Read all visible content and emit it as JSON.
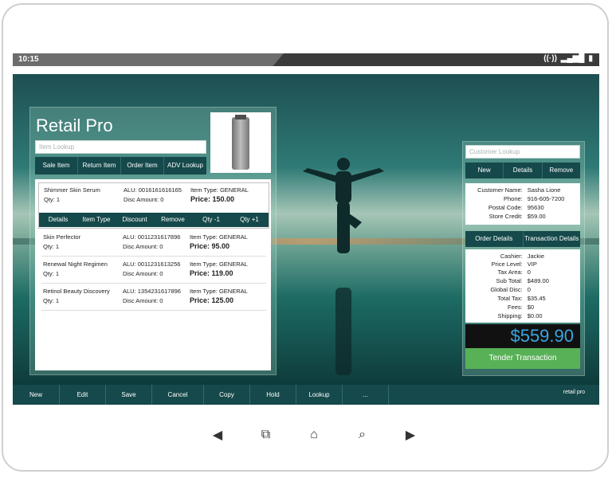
{
  "status": {
    "time": "10:15"
  },
  "app": {
    "title": "Retail Pro"
  },
  "left": {
    "lookup_placeholder": "Item Lookup",
    "buttons": [
      "Sale Item",
      "Return Item",
      "Order Item",
      "ADV Lookup"
    ],
    "items": [
      {
        "name": "Shimmer Skin Serum",
        "qty": "Qty: 1",
        "alu": "ALU: 0016161616165",
        "disc": "Disc Amount: 0",
        "type": "Item Type: GENERAL",
        "price": "Price: 150.00"
      },
      {
        "name": "Skin Perfector",
        "qty": "Qty: 1",
        "alu": "ALU: 0011231617896",
        "disc": "Disc Amount: 0",
        "type": "Item Type: GENERAL",
        "price": "Price: 95.00"
      },
      {
        "name": "Renewal Night Regimen",
        "qty": "Qty: 1",
        "alu": "ALU: 0011231613256",
        "disc": "Disc Amount: 0",
        "type": "Item Type: GENERAL",
        "price": "Price: 119.00"
      },
      {
        "name": "Retinol Beauty Discovery",
        "qty": "Qty: 1",
        "alu": "ALU: 1354231617896",
        "disc": "Disc Amount: 0",
        "type": "Item Type: GENERAL",
        "price": "Price: 125.00"
      }
    ],
    "actions": [
      "Details",
      "Item Type",
      "Discount",
      "Remove",
      "Qty -1",
      "Qty +1"
    ]
  },
  "customer": {
    "lookup_placeholder": "Customer Lookup",
    "buttons": [
      "New",
      "Details",
      "Remove"
    ],
    "fields": [
      {
        "k": "Customer Name:",
        "v": "Sasha Lione"
      },
      {
        "k": "Phone:",
        "v": "916-605-7200"
      },
      {
        "k": "Postal Code:",
        "v": "95630"
      },
      {
        "k": "Store Credit:",
        "v": "$59.00"
      }
    ],
    "tabs": [
      "Order Details",
      "Transaction Details"
    ],
    "order": [
      {
        "k": "Cashier:",
        "v": "Jackie"
      },
      {
        "k": "Price Level:",
        "v": "VIP"
      },
      {
        "k": "Tax Area:",
        "v": "0"
      },
      {
        "k": "Sub Total:",
        "v": "$489.00"
      },
      {
        "k": "Global Disc:",
        "v": "0"
      },
      {
        "k": "Total Tax:",
        "v": "$35.45"
      },
      {
        "k": "Fees:",
        "v": "$0"
      },
      {
        "k": "Shipping:",
        "v": "$0.00"
      }
    ],
    "total": "$559.90",
    "tender": "Tender Transaction"
  },
  "bottom": {
    "menu": [
      "New",
      "Edit",
      "Save",
      "Cancel",
      "Copy",
      "Hold",
      "Lookup",
      "..."
    ],
    "logo": "retail pro"
  }
}
